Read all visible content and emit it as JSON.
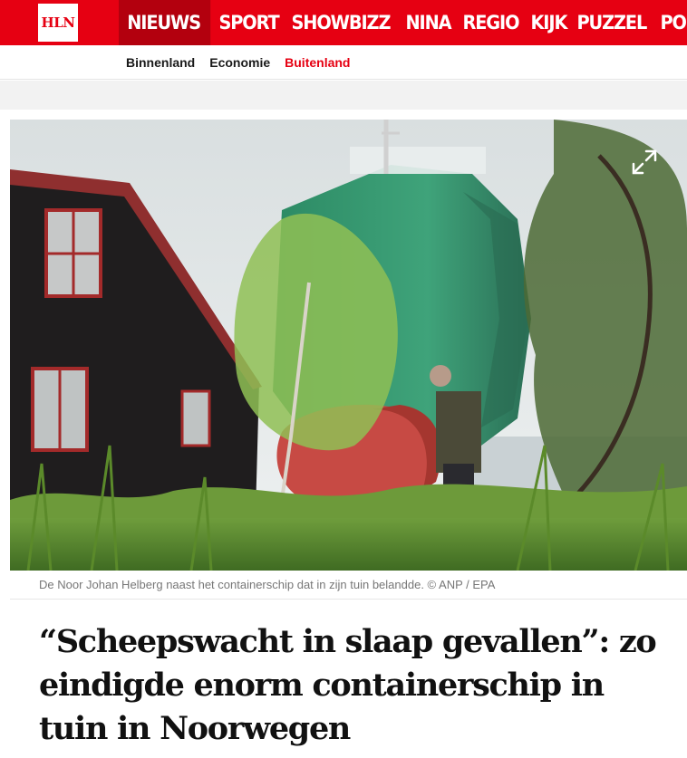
{
  "brand": {
    "logo_text": "HLN",
    "accent": "#e60012",
    "accent_dark": "#b3000e"
  },
  "nav": {
    "items": [
      {
        "label": "NIEUWS",
        "active": true
      },
      {
        "label": "SPORT"
      },
      {
        "label": "SHOWBIZZ"
      },
      {
        "label": "NINA"
      },
      {
        "label": "REGIO"
      },
      {
        "label": "KIJK"
      },
      {
        "label": "PUZZEL"
      },
      {
        "label": "PODC"
      }
    ]
  },
  "subnav": {
    "items": [
      {
        "label": "Binnenland"
      },
      {
        "label": "Economie"
      },
      {
        "label": "Buitenland",
        "current": true
      }
    ]
  },
  "article": {
    "image_icon": "expand-icon",
    "caption": "De Noor Johan Helberg naast het containerschip dat in zijn tuin belandde. © ANP / EPA",
    "headline": "“Scheepswacht in slaap gevallen”: zo eindigde enorm containerschip in tuin in Noorwegen"
  }
}
